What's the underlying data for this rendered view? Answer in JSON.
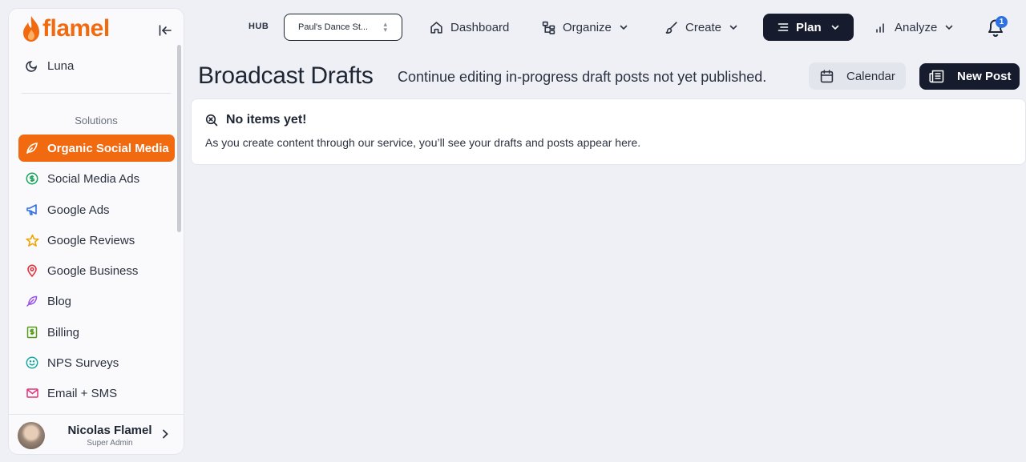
{
  "brand": {
    "name": "flamel",
    "color": "#f26a0f"
  },
  "sidebar": {
    "top_item": {
      "label": "Luna",
      "icon": "moon-icon"
    },
    "section_label": "Solutions",
    "items": [
      {
        "label": "Organic Social Media",
        "icon": "leaf-icon",
        "active": true
      },
      {
        "label": "Social Media Ads",
        "icon": "dollar-circle-icon"
      },
      {
        "label": "Google Ads",
        "icon": "megaphone-icon"
      },
      {
        "label": "Google Reviews",
        "icon": "star-icon"
      },
      {
        "label": "Google Business",
        "icon": "map-pin-icon"
      },
      {
        "label": "Blog",
        "icon": "feather-icon"
      },
      {
        "label": "Billing",
        "icon": "billing-icon"
      },
      {
        "label": "NPS Surveys",
        "icon": "smiley-icon"
      },
      {
        "label": "Email + SMS",
        "icon": "mail-icon"
      }
    ],
    "user": {
      "name": "Nicolas Flamel",
      "role": "Super Admin"
    }
  },
  "topbar": {
    "hub_label": "HUB",
    "hub_value": "Paul's Dance St...",
    "nav": [
      {
        "label": "Dashboard",
        "icon": "home-icon"
      },
      {
        "label": "Organize",
        "icon": "organize-icon"
      },
      {
        "label": "Create",
        "icon": "brush-icon"
      },
      {
        "label": "Plan",
        "icon": "list-icon",
        "active": true
      },
      {
        "label": "Analyze",
        "icon": "bar-chart-icon"
      }
    ],
    "notifications_count": "1"
  },
  "header": {
    "title": "Broadcast Drafts",
    "subtitle": "Continue editing in-progress draft posts not yet published.",
    "calendar_label": "Calendar",
    "new_post_label": "New Post"
  },
  "empty_state": {
    "title": "No items yet!",
    "description": "As you create content through our service, you’ll see your drafts and posts appear here."
  }
}
